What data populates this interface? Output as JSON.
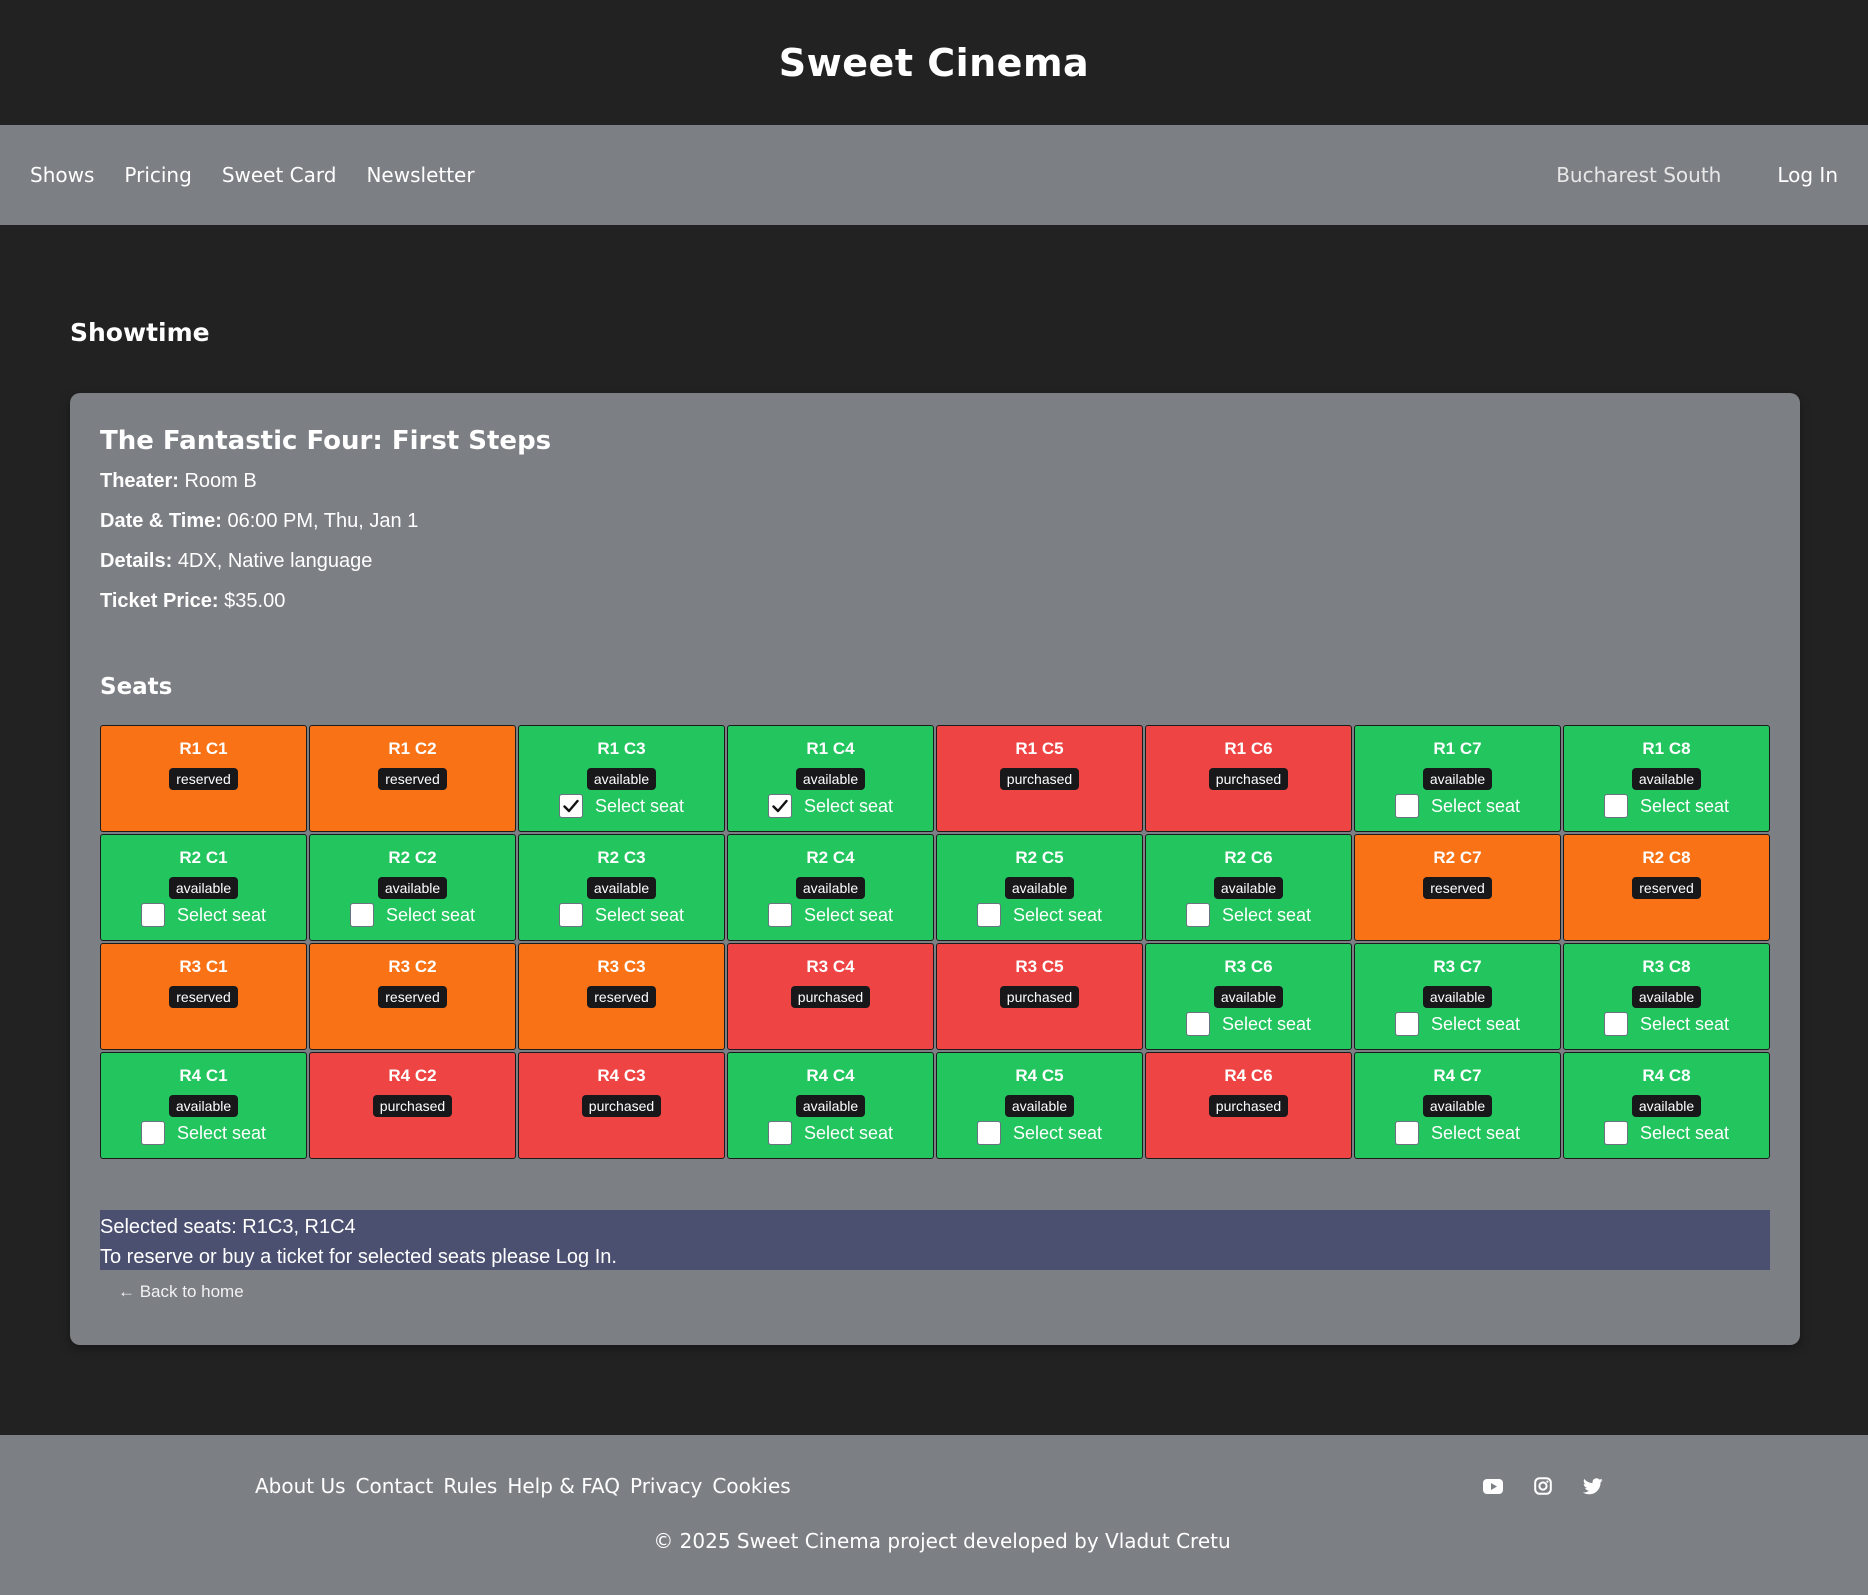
{
  "header": {
    "brand": "Sweet Cinema"
  },
  "nav": {
    "left": [
      "Shows",
      "Pricing",
      "Sweet Card",
      "Newsletter"
    ],
    "location": "Bucharest South",
    "login": "Log In"
  },
  "page": {
    "heading": "Showtime"
  },
  "showtime": {
    "movie_title": "The Fantastic Four: First Steps",
    "theater_label": "Theater:",
    "theater": "Room B",
    "datetime_label": "Date & Time:",
    "datetime": "06:00 PM, Thu, Jan 1",
    "details_label": "Details:",
    "details": "4DX, Native language",
    "price_label": "Ticket Price:",
    "price": "$35.00"
  },
  "seats_heading": "Seats",
  "select_label": "Select seat",
  "seats": [
    {
      "name": "R1 C1",
      "status": "reserved"
    },
    {
      "name": "R1 C2",
      "status": "reserved"
    },
    {
      "name": "R1 C3",
      "status": "available",
      "checked": true
    },
    {
      "name": "R1 C4",
      "status": "available",
      "checked": true
    },
    {
      "name": "R1 C5",
      "status": "purchased"
    },
    {
      "name": "R1 C6",
      "status": "purchased"
    },
    {
      "name": "R1 C7",
      "status": "available",
      "checked": false
    },
    {
      "name": "R1 C8",
      "status": "available",
      "checked": false
    },
    {
      "name": "R2 C1",
      "status": "available",
      "checked": false
    },
    {
      "name": "R2 C2",
      "status": "available",
      "checked": false
    },
    {
      "name": "R2 C3",
      "status": "available",
      "checked": false
    },
    {
      "name": "R2 C4",
      "status": "available",
      "checked": false
    },
    {
      "name": "R2 C5",
      "status": "available",
      "checked": false
    },
    {
      "name": "R2 C6",
      "status": "available",
      "checked": false
    },
    {
      "name": "R2 C7",
      "status": "reserved"
    },
    {
      "name": "R2 C8",
      "status": "reserved"
    },
    {
      "name": "R3 C1",
      "status": "reserved"
    },
    {
      "name": "R3 C2",
      "status": "reserved"
    },
    {
      "name": "R3 C3",
      "status": "reserved"
    },
    {
      "name": "R3 C4",
      "status": "purchased"
    },
    {
      "name": "R3 C5",
      "status": "purchased"
    },
    {
      "name": "R3 C6",
      "status": "available",
      "checked": false
    },
    {
      "name": "R3 C7",
      "status": "available",
      "checked": false
    },
    {
      "name": "R3 C8",
      "status": "available",
      "checked": false
    },
    {
      "name": "R4 C1",
      "status": "available",
      "checked": false
    },
    {
      "name": "R4 C2",
      "status": "purchased"
    },
    {
      "name": "R4 C3",
      "status": "purchased"
    },
    {
      "name": "R4 C4",
      "status": "available",
      "checked": false
    },
    {
      "name": "R4 C5",
      "status": "available",
      "checked": false
    },
    {
      "name": "R4 C6",
      "status": "purchased"
    },
    {
      "name": "R4 C7",
      "status": "available",
      "checked": false
    },
    {
      "name": "R4 C8",
      "status": "available",
      "checked": false
    }
  ],
  "selection": {
    "selected_text": "Selected seats: R1C3, R1C4",
    "hint": "To reserve or buy a ticket for selected seats please Log In."
  },
  "back_link": "← Back to home",
  "footer": {
    "links": [
      "About Us",
      "Contact",
      "Rules",
      "Help & FAQ",
      "Privacy",
      "Cookies"
    ],
    "socials": [
      "youtube-icon",
      "instagram-icon",
      "twitter-icon"
    ],
    "copyright": "© 2025 Sweet Cinema project developed by Vladut Cretu"
  },
  "colors": {
    "available": "#22c55e",
    "reserved": "#f97316",
    "purchased": "#ef4444",
    "selection_bar": "#4b4f70",
    "panel": "#7c7f84",
    "background": "#222222"
  }
}
